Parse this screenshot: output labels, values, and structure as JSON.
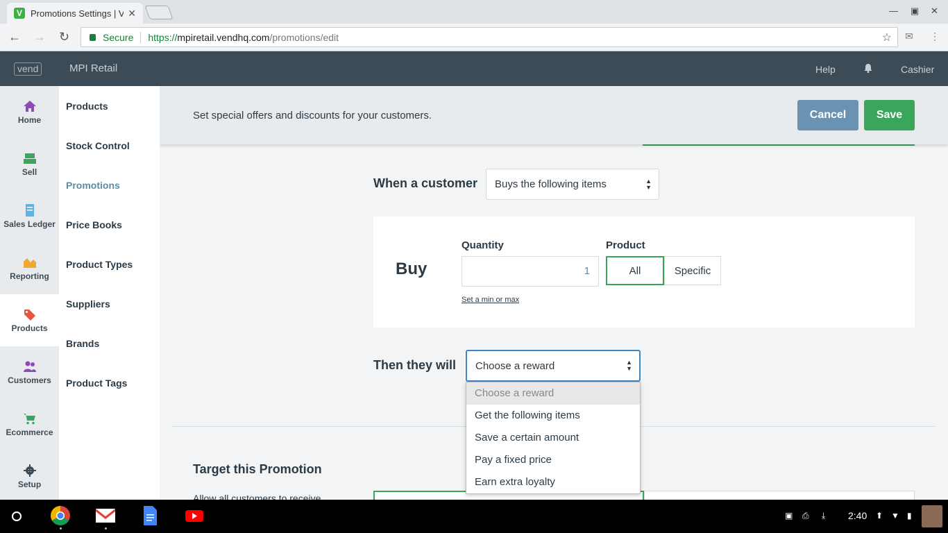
{
  "browser": {
    "tab_title": "Promotions Settings | Ve",
    "tab_favicon_letter": "V",
    "secure_label": "Secure",
    "url_scheme": "https://",
    "url_host": "mpiretail.vendhq.com",
    "url_path": "/promotions/edit"
  },
  "app": {
    "logo": "vend",
    "store_name": "MPI Retail",
    "help": "Help",
    "user": "Cashier"
  },
  "nav": {
    "home": "Home",
    "sell": "Sell",
    "sales_ledger": "Sales Ledger",
    "reporting": "Reporting",
    "products": "Products",
    "customers": "Customers",
    "ecommerce": "Ecommerce",
    "setup": "Setup"
  },
  "submenu": {
    "products": "Products",
    "stock_control": "Stock Control",
    "promotions": "Promotions",
    "price_books": "Price Books",
    "product_types": "Product Types",
    "suppliers": "Suppliers",
    "brands": "Brands",
    "product_tags": "Product Tags"
  },
  "header": {
    "description": "Set special offers and discounts for your customers.",
    "cancel": "Cancel",
    "save": "Save"
  },
  "condition": {
    "label": "When a customer",
    "selected": "Buys the following items"
  },
  "buy": {
    "title": "Buy",
    "quantity_label": "Quantity",
    "quantity_value": "1",
    "product_label": "Product",
    "product_all": "All",
    "product_specific": "Specific",
    "min_max_link": "Set a min or max"
  },
  "reward": {
    "label": "Then they will",
    "selected": "Choose a reward",
    "options": [
      "Choose a reward",
      "Get the following items",
      "Save a certain amount",
      "Pay a fixed price",
      "Earn extra loyalty"
    ]
  },
  "target": {
    "title": "Target this Promotion",
    "allow_text": "Allow all customers to receive"
  },
  "shelf": {
    "time": "2:40"
  }
}
